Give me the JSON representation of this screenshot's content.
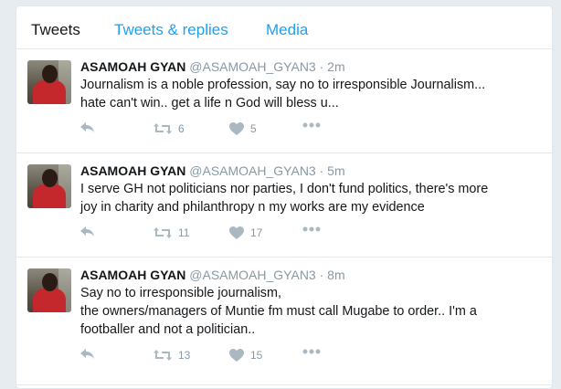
{
  "tabs": [
    {
      "label": "Tweets"
    },
    {
      "label": "Tweets & replies"
    },
    {
      "label": "Media"
    }
  ],
  "colors": {
    "accent": "#1da1f2",
    "muted": "#8899a6",
    "icon": "#aab8c2",
    "text": "#14171a"
  },
  "tweets": [
    {
      "name": "ASAMOAH GYAN",
      "handle": "@ASAMOAH_GYAN3",
      "separator": "·",
      "time": "2m",
      "text": "Journalism is a noble profession,  say no to irresponsible Journalism...\nhate can't win.. get a life n God will bless u...",
      "retweets": "6",
      "likes": "5"
    },
    {
      "name": "ASAMOAH GYAN",
      "handle": "@ASAMOAH_GYAN3",
      "separator": "·",
      "time": "5m",
      "text": "I serve GH not politicians nor parties,  I don't fund politics, there's more\njoy in charity and philanthropy n my works are my evidence",
      "retweets": "11",
      "likes": "17"
    },
    {
      "name": "ASAMOAH GYAN",
      "handle": "@ASAMOAH_GYAN3",
      "separator": "·",
      "time": "8m",
      "text": "Say no to irresponsible journalism,\nthe owners/managers of Muntie fm must call Mugabe to order..  I'm a\nfootballer and not a politician..",
      "retweets": "13",
      "likes": "15"
    }
  ],
  "icons": {
    "reply": "reply-icon",
    "retweet": "retweet-icon",
    "like": "heart-icon",
    "more": "more-dots-icon"
  }
}
